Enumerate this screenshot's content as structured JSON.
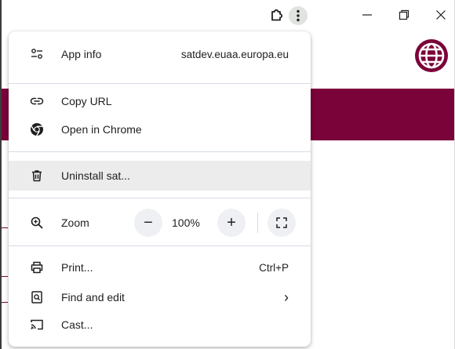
{
  "window": {
    "extensions_icon": "puzzle-icon",
    "menu_icon": "three-dots-icon",
    "controls": [
      "minimize-icon",
      "restore-icon",
      "close-icon"
    ]
  },
  "colors": {
    "app_brand": "#7a0339",
    "menu_bg": "#ffffff",
    "highlight": "#ececec",
    "separator": "#d6dbe6"
  },
  "menu": {
    "app_info": {
      "label": "App info",
      "value": "satdev.euaa.europa.eu",
      "icon": "tune-icon"
    },
    "copy_url": {
      "label": "Copy URL",
      "icon": "link-icon"
    },
    "open_in_chrome": {
      "label": "Open in Chrome",
      "icon": "chrome-icon"
    },
    "uninstall": {
      "label": "Uninstall sat...",
      "icon": "trash-icon"
    },
    "zoom": {
      "label": "Zoom",
      "value": "100%",
      "minus": "−",
      "plus": "+",
      "icon": "zoom-in-icon",
      "fullscreen_icon": "fullscreen-icon"
    },
    "print": {
      "label": "Print...",
      "shortcut": "Ctrl+P",
      "icon": "printer-icon"
    },
    "find_and_edit": {
      "label": "Find and edit",
      "chevron": "›",
      "icon": "find-page-icon"
    },
    "cast": {
      "label": "Cast...",
      "icon": "cast-icon"
    }
  }
}
